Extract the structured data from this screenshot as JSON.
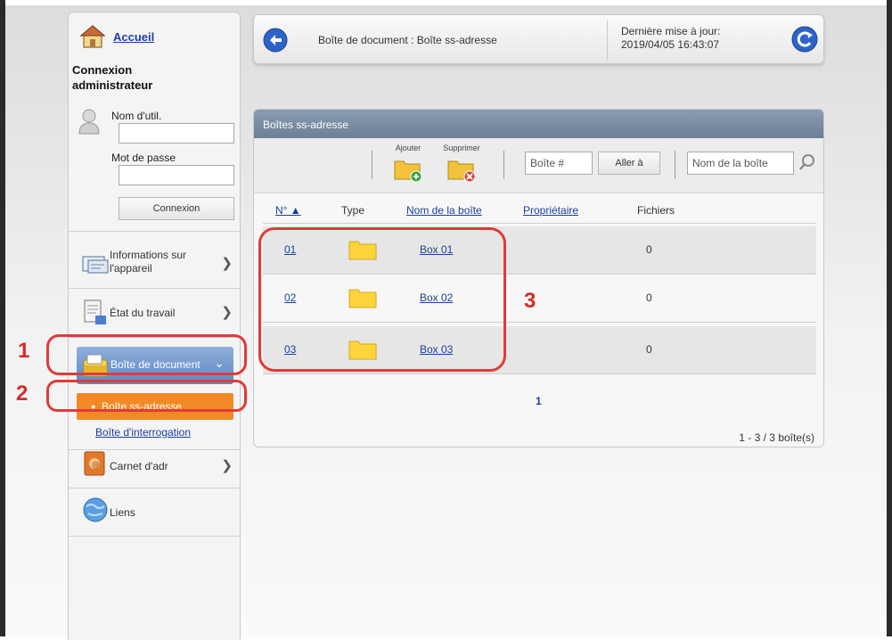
{
  "sidebar": {
    "home_label": "Accueil",
    "admin_title_line1": "Connexion",
    "admin_title_line2": "administrateur",
    "username_label": "Nom d'util.",
    "username_value": "",
    "password_label": "Mot de passe",
    "password_value": "",
    "login_button": "Connexion",
    "items": [
      {
        "label_line1": "Informations sur",
        "label_line2": "l'appareil",
        "icon": "device-info-icon"
      },
      {
        "label_line1": "État du travail",
        "label_line2": "",
        "icon": "job-status-icon"
      },
      {
        "label_line1": "Boîte de document",
        "label_line2": "",
        "icon": "document-box-icon"
      },
      {
        "label_line1": "Carnet d'adr",
        "label_line2": "",
        "icon": "address-book-icon"
      },
      {
        "label_line1": "Liens",
        "label_line2": "",
        "icon": "globe-icon"
      }
    ],
    "subitems": [
      {
        "label": "Boîte ss-adresse",
        "active": true
      },
      {
        "label": "Boîte d'interrogation",
        "active": false
      }
    ]
  },
  "header": {
    "breadcrumb": "Boîte de document : Boîte ss-adresse",
    "last_update_label": "Dernière mise à jour:",
    "last_update_value": "2019/04/05 16:43:07"
  },
  "panel": {
    "title": "Boîtes ss-adresse",
    "toolbar": {
      "add_label": "Ajouter",
      "delete_label": "Supprimer",
      "box_number_placeholder": "Boîte #",
      "goto_button": "Aller à",
      "box_name_placeholder": "Nom de la boîte"
    },
    "columns": [
      "N° ▲",
      "Type",
      "Nom de la boîte",
      "Propriétaire",
      "Fichiers"
    ],
    "rows": [
      {
        "num": "01",
        "name": "Box 01",
        "owner": "",
        "files": "0"
      },
      {
        "num": "02",
        "name": "Box 02",
        "owner": "",
        "files": "0"
      },
      {
        "num": "03",
        "name": "Box 03",
        "owner": "",
        "files": "0"
      }
    ],
    "page": "1",
    "count_text": "1 - 3 / 3 boîte(s)"
  },
  "callouts": {
    "one": "1",
    "two": "2",
    "three": "3"
  },
  "colors": {
    "accent_orange": "#f08a24",
    "active_blue": "#6f92c8",
    "link": "#1b3fa0",
    "callout_red": "#e03a3a"
  }
}
